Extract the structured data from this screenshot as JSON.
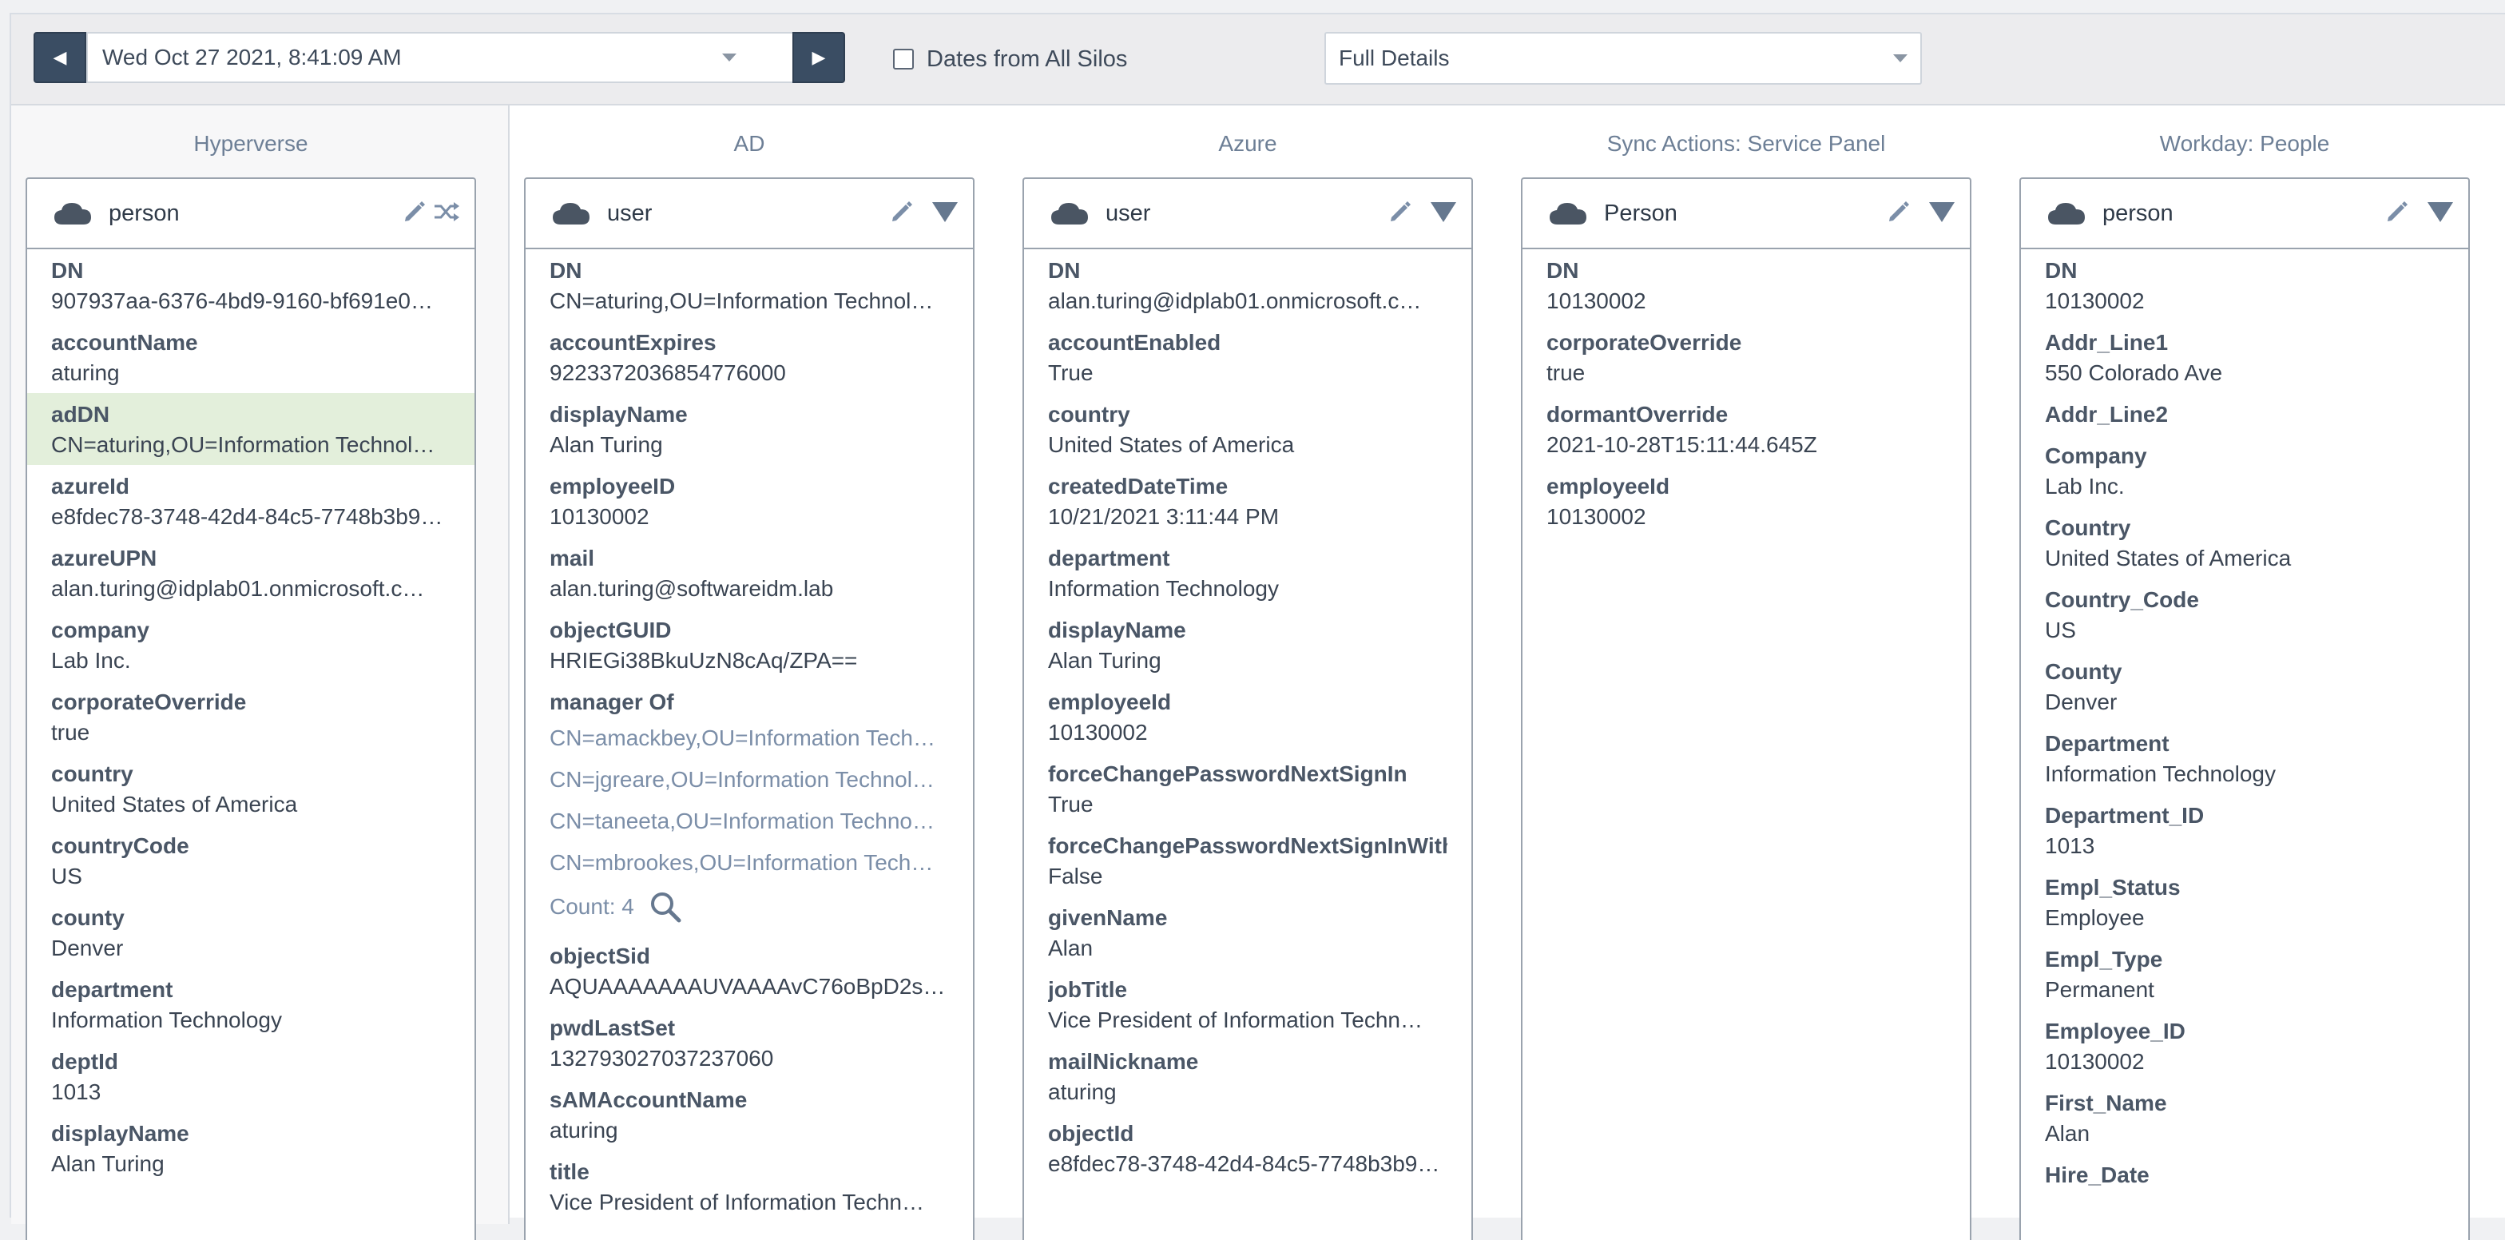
{
  "toolbar": {
    "date": "Wed Oct 27 2021, 8:41:09 AM",
    "silos_label": "Dates from All Silos",
    "detail_level": "Full Details",
    "prev_icon": "◀",
    "next_icon": "▶"
  },
  "columns": [
    {
      "title": "Hyperverse",
      "object": "person",
      "attrs": [
        {
          "name": "DN",
          "value": "907937aa-6376-4bd9-9160-bf691e0…"
        },
        {
          "name": "accountName",
          "value": "aturing"
        },
        {
          "name": "adDN",
          "value": "CN=aturing,OU=Information Technol…",
          "highlight": true
        },
        {
          "name": "azureId",
          "value": "e8fdec78-3748-42d4-84c5-7748b3b9…"
        },
        {
          "name": "azureUPN",
          "value": "alan.turing@idplab01.onmicrosoft.c…"
        },
        {
          "name": "company",
          "value": "Lab Inc."
        },
        {
          "name": "corporateOverride",
          "value": "true"
        },
        {
          "name": "country",
          "value": "United States of America"
        },
        {
          "name": "countryCode",
          "value": "US"
        },
        {
          "name": "county",
          "value": "Denver"
        },
        {
          "name": "department",
          "value": "Information Technology"
        },
        {
          "name": "deptId",
          "value": "1013"
        },
        {
          "name": "displayName",
          "value": "Alan Turing"
        }
      ]
    },
    {
      "title": "AD",
      "object": "user",
      "attrs_before": [
        {
          "name": "DN",
          "value": "CN=aturing,OU=Information Technol…"
        },
        {
          "name": "accountExpires",
          "value": "9223372036854776000"
        },
        {
          "name": "displayName",
          "value": "Alan Turing"
        },
        {
          "name": "employeeID",
          "value": "10130002"
        },
        {
          "name": "mail",
          "value": "alan.turing@softwareidm.lab"
        },
        {
          "name": "objectGUID",
          "value": "HRIEGi38BkuUzN8cAq/ZPA=="
        }
      ],
      "manager_of": {
        "name": "manager Of",
        "links": [
          "CN=amackbey,OU=Information Tech…",
          "CN=jgreare,OU=Information Technol…",
          "CN=taneeta,OU=Information Techno…",
          "CN=mbrookes,OU=Information Tech…"
        ],
        "count": "Count: 4"
      },
      "attrs_after": [
        {
          "name": "objectSid",
          "value": "AQUAAAAAAAUVAAAAvC76oBpD2so…"
        },
        {
          "name": "pwdLastSet",
          "value": "132793027037237060"
        },
        {
          "name": "sAMAccountName",
          "value": "aturing"
        },
        {
          "name": "title",
          "value": "Vice President of Information Techn…"
        }
      ]
    },
    {
      "title": "Azure",
      "object": "user",
      "attrs": [
        {
          "name": "DN",
          "value": "alan.turing@idplab01.onmicrosoft.c…"
        },
        {
          "name": "accountEnabled",
          "value": "True"
        },
        {
          "name": "country",
          "value": "United States of America"
        },
        {
          "name": "createdDateTime",
          "value": "10/21/2021 3:11:44 PM"
        },
        {
          "name": "department",
          "value": "Information Technology"
        },
        {
          "name": "displayName",
          "value": "Alan Turing"
        },
        {
          "name": "employeeId",
          "value": "10130002"
        },
        {
          "name": "forceChangePasswordNextSignIn",
          "value": "True"
        },
        {
          "name": "forceChangePasswordNextSignInWithM",
          "value": "False"
        },
        {
          "name": "givenName",
          "value": "Alan"
        },
        {
          "name": "jobTitle",
          "value": "Vice President of Information Techn…"
        },
        {
          "name": "mailNickname",
          "value": "aturing"
        },
        {
          "name": "objectId",
          "value": "e8fdec78-3748-42d4-84c5-7748b3b9…"
        }
      ]
    },
    {
      "title": "Sync Actions: Service Panel",
      "object": "Person",
      "attrs": [
        {
          "name": "DN",
          "value": "10130002"
        },
        {
          "name": "corporateOverride",
          "value": "true"
        },
        {
          "name": "dormantOverride",
          "value": "2021-10-28T15:11:44.645Z"
        },
        {
          "name": "employeeId",
          "value": "10130002"
        }
      ]
    },
    {
      "title": "Workday: People",
      "object": "person",
      "attrs": [
        {
          "name": "DN",
          "value": "10130002"
        },
        {
          "name": "Addr_Line1",
          "value": "550 Colorado Ave"
        },
        {
          "name": "Addr_Line2",
          "value": ""
        },
        {
          "name": "Company",
          "value": "Lab Inc."
        },
        {
          "name": "Country",
          "value": "United States of America"
        },
        {
          "name": "Country_Code",
          "value": "US"
        },
        {
          "name": "County",
          "value": "Denver"
        },
        {
          "name": "Department",
          "value": "Information Technology"
        },
        {
          "name": "Department_ID",
          "value": "1013"
        },
        {
          "name": "Empl_Status",
          "value": "Employee"
        },
        {
          "name": "Empl_Type",
          "value": "Permanent"
        },
        {
          "name": "Employee_ID",
          "value": "10130002"
        },
        {
          "name": "First_Name",
          "value": "Alan"
        },
        {
          "name": "Hire_Date",
          "value": ""
        }
      ]
    }
  ],
  "colors": {
    "nav_button": "#3a4d63",
    "highlight_row": "#e3efdb",
    "link": "#7b8ea8",
    "column_title": "#6d7f96"
  }
}
